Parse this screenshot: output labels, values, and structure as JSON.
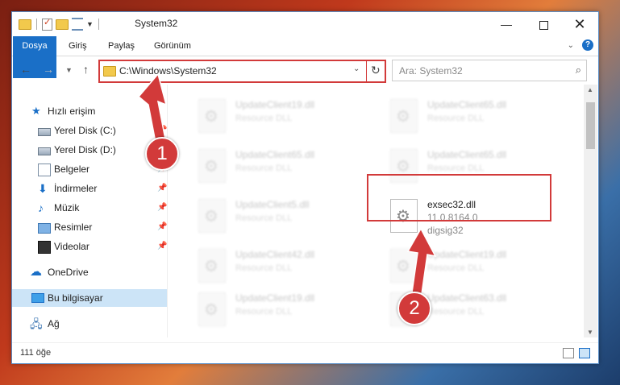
{
  "window": {
    "title": "System32"
  },
  "ribbon": {
    "tabs": [
      {
        "label": "Dosya"
      },
      {
        "label": "Giriş"
      },
      {
        "label": "Paylaş"
      },
      {
        "label": "Görünüm"
      }
    ],
    "help": "?"
  },
  "navigation": {
    "address": "C:\\Windows\\System32",
    "search_placeholder": "Ara: System32"
  },
  "sidebar": {
    "items": [
      {
        "label": "Hızlı erişim",
        "icon": "star-icon"
      },
      {
        "label": "Yerel Disk (C:)",
        "icon": "drive-icon",
        "pinned": true
      },
      {
        "label": "Yerel Disk (D:)",
        "icon": "drive-icon",
        "pinned": true
      },
      {
        "label": "Belgeler",
        "icon": "document-icon",
        "pinned": true
      },
      {
        "label": "İndirmeler",
        "icon": "download-icon",
        "pinned": true
      },
      {
        "label": "Müzik",
        "icon": "music-icon",
        "pinned": true
      },
      {
        "label": "Resimler",
        "icon": "pictures-icon",
        "pinned": true
      },
      {
        "label": "Videolar",
        "icon": "video-icon",
        "pinned": true
      },
      {
        "label": "OneDrive",
        "icon": "cloud-icon"
      },
      {
        "label": "Bu bilgisayar",
        "icon": "computer-icon",
        "selected": true
      },
      {
        "label": "Ağ",
        "icon": "network-icon"
      }
    ]
  },
  "files": [
    {
      "name": "UpdateClient19.dll",
      "type": "Resource DLL"
    },
    {
      "name": "UpdateClient65.dll",
      "type": "Resource DLL"
    },
    {
      "name": "UpdateClient65.dll",
      "type": "Resource DLL"
    },
    {
      "name": "UpdateClient65.dll",
      "type": "Resource DLL"
    },
    {
      "name": "UpdateClient5.dll",
      "type": "Resource DLL"
    },
    {
      "name": "exsec32.dll",
      "version": "11.0.8164.0",
      "description": "digsig32",
      "highlighted": true
    },
    {
      "name": "UpdateClient42.dll",
      "type": "Resource DLL"
    },
    {
      "name": "UpdateClient19.dll",
      "type": "Resource DLL"
    },
    {
      "name": "UpdateClient19.dll",
      "type": "Resource DLL"
    },
    {
      "name": "UpdateClient63.dll",
      "type": "Resource DLL"
    }
  ],
  "status": {
    "count": "111 öğe"
  },
  "annotations": {
    "step1": "1",
    "step2": "2",
    "color": "#d23a3a"
  }
}
